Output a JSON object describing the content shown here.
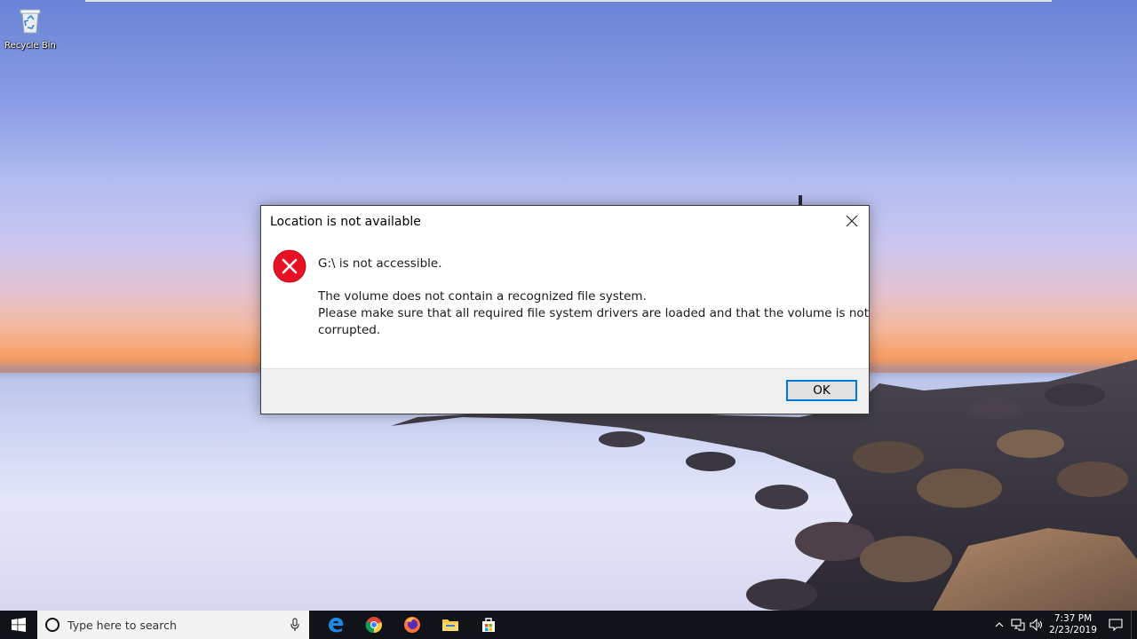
{
  "desktop": {
    "icons": [
      {
        "label": "Recycle Bin",
        "icon": "recycle-bin-icon"
      }
    ]
  },
  "dialog": {
    "title": "Location is not available",
    "close_icon": "close-icon",
    "error_icon": "error-icon",
    "primary_message": "G:\\ is not accessible.",
    "body_lines": [
      "The volume does not contain a recognized file system.",
      "Please make sure that all required file system drivers are loaded and that the volume is not",
      "corrupted."
    ],
    "ok_label": "OK",
    "accent_color": "#0078d7",
    "error_color": "#e81123"
  },
  "taskbar": {
    "start_icon": "windows-start-icon",
    "search_placeholder": "Type here to search",
    "pinned_apps": [
      "edge-icon",
      "chrome-icon",
      "firefox-icon",
      "file-explorer-icon",
      "store-icon"
    ],
    "tray": {
      "icons": [
        "chevron-up-icon",
        "network-icon",
        "volume-icon"
      ],
      "time": "7:37 PM",
      "date": "2/23/2019",
      "notification_icon": "action-center-icon"
    }
  }
}
